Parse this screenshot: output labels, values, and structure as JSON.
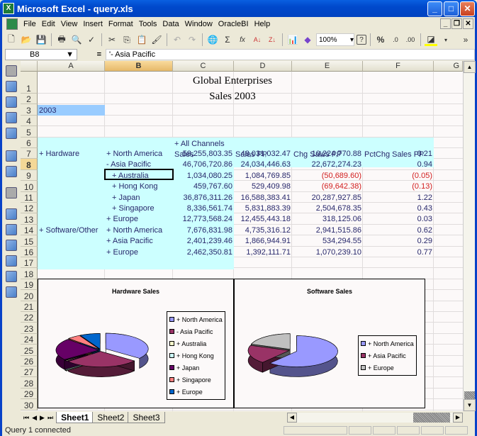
{
  "window": {
    "title": "Microsoft Excel - query.xls",
    "buttons": {
      "minimize": "_",
      "maximize": "□",
      "close": "✕"
    }
  },
  "menubar": {
    "items": [
      "File",
      "Edit",
      "View",
      "Insert",
      "Format",
      "Tools",
      "Data",
      "Window",
      "OracleBI",
      "Help"
    ],
    "mdi": {
      "minimize": "_",
      "restore": "❐",
      "close": "✕"
    }
  },
  "toolbar": {
    "zoom": "100%",
    "icons": [
      "new-icon",
      "open-icon",
      "save-icon",
      "print-icon",
      "print-preview-icon",
      "spelling-icon",
      "cut-icon",
      "copy-icon",
      "paste-icon",
      "format-painter-icon",
      "undo-icon",
      "redo-icon",
      "hyperlink-icon",
      "autosum-icon",
      "function-icon",
      "sort-ascending-icon",
      "sort-descending-icon",
      "chart-wizard-icon",
      "drawing-icon",
      "help-icon",
      "percent-icon",
      "increase-decimal-icon",
      "decrease-decimal-icon",
      "fill-color-icon",
      "toolbar-options-icon"
    ],
    "glyphs": {
      "new": "🗋",
      "open": "📂",
      "save": "💾",
      "print": "🖶",
      "preview": "🔍",
      "spell": "✓",
      "cut": "✂",
      "copy": "⎘",
      "paste": "📋",
      "painter": "🖌",
      "undo": "↶",
      "redo": "↷",
      "hyperlink": "🌐",
      "sum": "Σ",
      "fx": "fx",
      "sortasc": "A↓",
      "sortdesc": "Z↓",
      "chart": "📊",
      "draw": "◆",
      "help": "?",
      "percent": "%",
      "incdec": ".0",
      "decdec": ".00",
      "fill": "◪",
      "more": "»"
    }
  },
  "formula_bar": {
    "name_box": "B8",
    "equals": "=",
    "content": "'- Asia Pacific"
  },
  "columns": [
    "A",
    "B",
    "C",
    "D",
    "E",
    "F",
    "G"
  ],
  "selected_column": "B",
  "rows": [
    "1",
    "2",
    "3",
    "4",
    "5",
    "6",
    "7",
    "8",
    "9",
    "10",
    "11",
    "12",
    "13",
    "14",
    "15",
    "16",
    "17",
    "18",
    "19",
    "20",
    "21",
    "22",
    "23",
    "24",
    "25",
    "26",
    "27",
    "28",
    "29",
    "30"
  ],
  "selected_row": "8",
  "sheet": {
    "title_line1": "Global Enterprises",
    "title_line2": "Sales 2003",
    "a2": "2003",
    "c5": "+ All Channels",
    "headers": [
      "Sales",
      "Sales PP",
      "Chg Sales PP",
      "PctChg Sales PP"
    ],
    "data_rows": [
      {
        "row": "7",
        "a": "+ Hardware",
        "b": "+ North America",
        "c": "58,255,803.35",
        "d": "48,031,032.47",
        "e": "10,224,770.88",
        "f": "0.21",
        "neg_e": false,
        "neg_f": false
      },
      {
        "row": "8",
        "a": "",
        "b": "- Asia Pacific",
        "c": "46,706,720.86",
        "d": "24,034,446.63",
        "e": "22,672,274.23",
        "f": "0.94",
        "neg_e": false,
        "neg_f": false
      },
      {
        "row": "9",
        "a": "",
        "b": "+ Australia",
        "c": "1,034,080.25",
        "d": "1,084,769.85",
        "e": "(50,689.60)",
        "f": "(0.05)",
        "neg_e": true,
        "neg_f": true
      },
      {
        "row": "10",
        "a": "",
        "b": "+ Hong Kong",
        "c": "459,767.60",
        "d": "529,409.98",
        "e": "(69,642.38)",
        "f": "(0.13)",
        "neg_e": true,
        "neg_f": true
      },
      {
        "row": "11",
        "a": "",
        "b": "+ Japan",
        "c": "36,876,311.26",
        "d": "16,588,383.41",
        "e": "20,287,927.85",
        "f": "1.22",
        "neg_e": false,
        "neg_f": false
      },
      {
        "row": "12",
        "a": "",
        "b": "+ Singapore",
        "c": "8,336,561.74",
        "d": "5,831,883.39",
        "e": "2,504,678.35",
        "f": "0.43",
        "neg_e": false,
        "neg_f": false
      },
      {
        "row": "13",
        "a": "",
        "b": "+ Europe",
        "c": "12,773,568.24",
        "d": "12,455,443.18",
        "e": "318,125.06",
        "f": "0.03",
        "neg_e": false,
        "neg_f": false
      },
      {
        "row": "14",
        "a": "+ Software/Other",
        "b": "+ North America",
        "c": "7,676,831.98",
        "d": "4,735,316.12",
        "e": "2,941,515.86",
        "f": "0.62",
        "neg_e": false,
        "neg_f": false
      },
      {
        "row": "15",
        "a": "",
        "b": "+ Asia Pacific",
        "c": "2,401,239.46",
        "d": "1,866,944.91",
        "e": "534,294.55",
        "f": "0.29",
        "neg_e": false,
        "neg_f": false
      },
      {
        "row": "16",
        "a": "",
        "b": "+ Europe",
        "c": "2,462,350.81",
        "d": "1,392,111.71",
        "e": "1,070,239.10",
        "f": "0.77",
        "neg_e": false,
        "neg_f": false
      }
    ]
  },
  "chart_data": [
    {
      "type": "pie",
      "title": "Hardware Sales",
      "legend_position": "right",
      "categories": [
        "+ North America",
        "- Asia Pacific",
        "+ Australia",
        "+ Hong Kong",
        "+ Japan",
        "+ Singapore",
        "+ Europe"
      ],
      "values": [
        58255803.35,
        46706720.86,
        1034080.25,
        459767.6,
        36876311.26,
        8336561.74,
        12773568.24
      ],
      "colors": [
        "#9999FF",
        "#993366",
        "#FFFFCC",
        "#CCFFFF",
        "#660066",
        "#FF8080",
        "#0066CC"
      ]
    },
    {
      "type": "pie",
      "title": "Software Sales",
      "legend_position": "right",
      "categories": [
        "+ North America",
        "+ Asia Pacific",
        "+ Europe"
      ],
      "values": [
        7676831.98,
        2401239.46,
        2462350.81
      ],
      "colors": [
        "#9999FF",
        "#993366",
        "#C0C0C0"
      ]
    }
  ],
  "tabs": [
    "Sheet1",
    "Sheet2",
    "Sheet3"
  ],
  "active_tab": "Sheet1",
  "status": {
    "text": "Query 1 connected"
  }
}
